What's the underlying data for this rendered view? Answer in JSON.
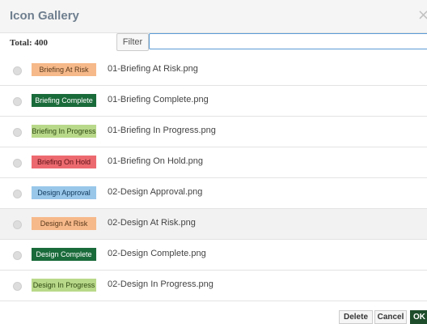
{
  "dialog": {
    "title": "Icon Gallery",
    "close_symbol": "×"
  },
  "filterbar": {
    "total_label": "Total: 400",
    "filter_button_label": "Filter",
    "filter_value": "",
    "filter_placeholder": ""
  },
  "items": [
    {
      "badge_label": "Briefing At Risk",
      "badge_bg": "#f6b98a",
      "badge_fg": "#5b3a1c",
      "filename": "01-Briefing At Risk.png"
    },
    {
      "badge_label": "Briefing Complete",
      "badge_bg": "#1a6b3a",
      "badge_fg": "#ffffff",
      "filename": "01-Briefing Complete.png"
    },
    {
      "badge_label": "Briefing In Progress",
      "badge_bg": "#b9d98a",
      "badge_fg": "#2f4a12",
      "filename": "01-Briefing In Progress.png"
    },
    {
      "badge_label": "Briefing On Hold",
      "badge_bg": "#ec6a6f",
      "badge_fg": "#5a1014",
      "filename": "01-Briefing On Hold.png"
    },
    {
      "badge_label": "Design Approval",
      "badge_bg": "#99c7ea",
      "badge_fg": "#123a5c",
      "filename": "02-Design Approval.png"
    },
    {
      "badge_label": "Design At Risk",
      "badge_bg": "#f6b98a",
      "badge_fg": "#5b3a1c",
      "filename": "02-Design At Risk.png"
    },
    {
      "badge_label": "Design Complete",
      "badge_bg": "#1a6b3a",
      "badge_fg": "#ffffff",
      "filename": "02-Design Complete.png"
    },
    {
      "badge_label": "Design In Progress",
      "badge_bg": "#b9d98a",
      "badge_fg": "#2f4a12",
      "filename": "02-Design In Progress.png"
    }
  ],
  "footer": {
    "delete_label": "Delete",
    "cancel_label": "Cancel",
    "ok_label": "OK"
  }
}
